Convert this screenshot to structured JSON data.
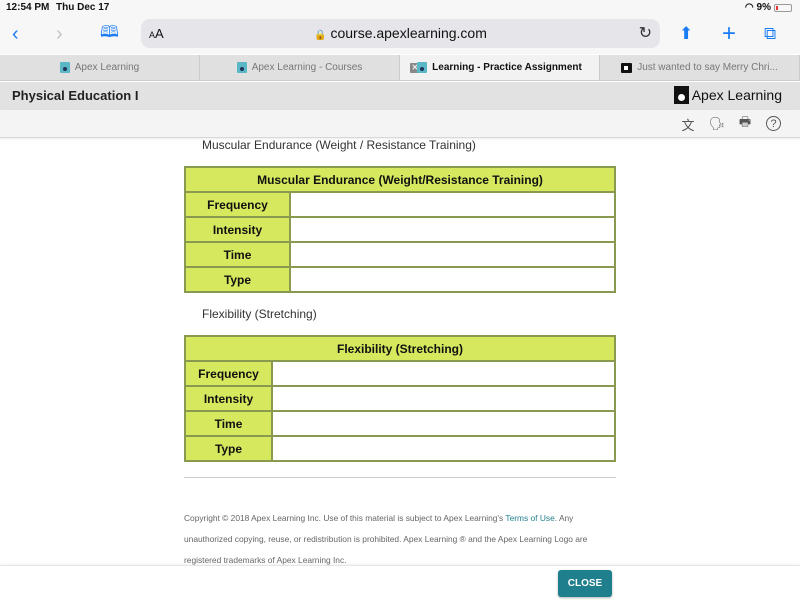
{
  "status_bar": {
    "time": "12:54 PM",
    "date": "Thu Dec 17",
    "battery": "9%"
  },
  "browser": {
    "text_size_label": "AA",
    "url": "course.apexlearning.com",
    "icons": [
      "back-icon",
      "forward-icon",
      "bookmarks-icon",
      "lock-icon",
      "reload-icon",
      "share-icon",
      "new-tab-icon",
      "tabs-overview-icon"
    ]
  },
  "tabs": [
    {
      "label": "Apex Learning",
      "active": false
    },
    {
      "label": "Apex Learning - Courses",
      "active": false
    },
    {
      "label": "Learning - Practice Assignment",
      "active": true
    },
    {
      "label": "Just wanted to say Merry Chri...",
      "active": false
    }
  ],
  "app": {
    "course_title": "Physical Education I",
    "logo_text": "Apex Learning",
    "tools": [
      "translate-icon",
      "read-aloud-icon",
      "print-icon",
      "help-icon"
    ]
  },
  "sections": [
    {
      "label": "Muscular Endurance (Weight / Resistance Training)",
      "table_title": "Muscular Endurance (Weight/Resistance Training)",
      "rows": [
        {
          "label": "Frequency",
          "value": ""
        },
        {
          "label": "Intensity",
          "value": ""
        },
        {
          "label": "Time",
          "value": ""
        },
        {
          "label": "Type",
          "value": ""
        }
      ]
    },
    {
      "label": "Flexibility (Stretching)",
      "table_title": "Flexibility (Stretching)",
      "rows": [
        {
          "label": "Frequency",
          "value": ""
        },
        {
          "label": "Intensity",
          "value": ""
        },
        {
          "label": "Time",
          "value": ""
        },
        {
          "label": "Type",
          "value": ""
        }
      ]
    }
  ],
  "footer": {
    "text_before_link": "Copyright © 2018 Apex Learning Inc. Use of this material is subject to Apex Learning's ",
    "link_text": "Terms of Use",
    "text_after_link": ". Any unauthorized copying, reuse, or redistribution is prohibited. Apex Learning ® and the Apex Learning Logo are registered trademarks of Apex Learning Inc."
  },
  "close_button": "CLOSE",
  "colors": {
    "table_header": "#d5e85e",
    "table_border": "#8a9950",
    "accent": "#1f7f8c",
    "browser_blue": "#1a7cf5"
  }
}
